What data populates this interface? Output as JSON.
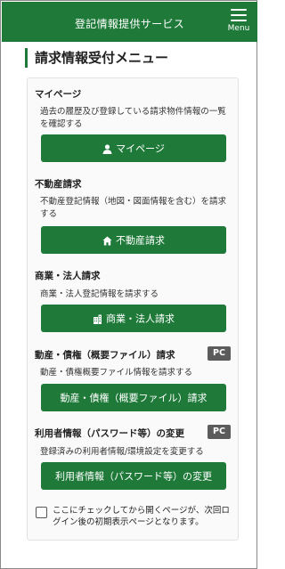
{
  "header": {
    "title": "登記情報提供サービス",
    "menu_label": "Menu"
  },
  "page_title": "請求情報受付メニュー",
  "sections": [
    {
      "title": "マイページ",
      "description": "過去の履歴及び登録している請求物件情報の一覧を確認する",
      "button_label": "マイページ",
      "button_icon": "person-icon"
    },
    {
      "title": "不動産請求",
      "description": "不動産登記情報（地図・図面情報を含む）を請求する",
      "button_label": "不動産請求",
      "button_icon": "house-icon"
    },
    {
      "title": "商業・法人請求",
      "description": "商業・法人登記情報を請求する",
      "button_label": "商業・法人請求",
      "button_icon": "building-icon"
    },
    {
      "title": "動産・債権（概要ファイル）請求",
      "description": "動産・債権概要ファイル情報を請求する",
      "button_label": "動産・債権（概要ファイル）請求",
      "badge": "PC"
    },
    {
      "title": "利用者情報（パスワード等）の変更",
      "description": "登録済みの利用者情報/環境設定を変更する",
      "button_label": "利用者情報（パスワード等）の変更",
      "badge": "PC"
    }
  ],
  "default_page_checkbox": {
    "label": "ここにチェックしてから開くページが、次回ログイン後の初期表示ページとなります。",
    "checked": false
  },
  "colors": {
    "brand_green": "#1f7a3a",
    "badge_gray": "#5b5b5b"
  }
}
